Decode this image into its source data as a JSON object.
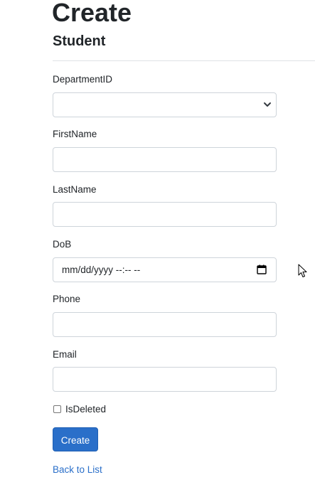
{
  "header": {
    "title": "Create",
    "subtitle": "Student"
  },
  "form": {
    "department": {
      "label": "DepartmentID",
      "value": ""
    },
    "first_name": {
      "label": "FirstName",
      "value": ""
    },
    "last_name": {
      "label": "LastName",
      "value": ""
    },
    "dob": {
      "label": "DoB",
      "value": "mm/dd/yyyy --:-- --"
    },
    "phone": {
      "label": "Phone",
      "value": ""
    },
    "email": {
      "label": "Email",
      "value": ""
    },
    "is_deleted": {
      "label": "IsDeleted",
      "checked": false
    },
    "submit_label": "Create"
  },
  "footer": {
    "back_link": "Back to List"
  },
  "icons": {
    "select": "chevron-down-icon",
    "date": "calendar-icon",
    "cursor": "mouse-cursor-icon"
  },
  "colors": {
    "accent": "#2a6fc9",
    "border": "#ced4da",
    "text": "#212529"
  }
}
